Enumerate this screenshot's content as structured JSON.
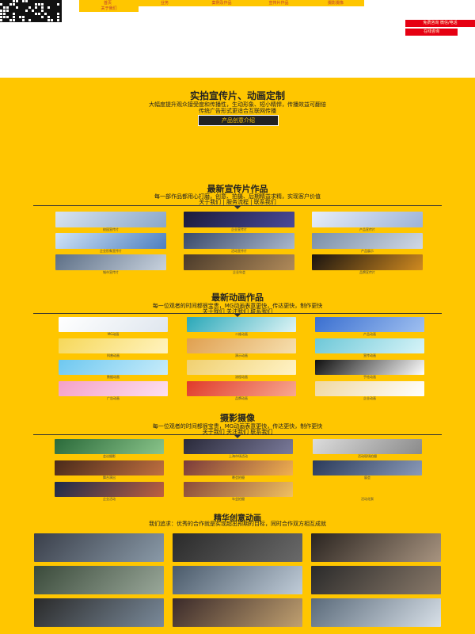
{
  "nav": {
    "items": [
      "首页",
      "业务",
      "案例及作品",
      "宣传片作品",
      "摄影摄像"
    ],
    "secondary": "关于我们"
  },
  "header": {
    "contact_button": "免费咨询 微信/电话",
    "consult_button": "在线咨询"
  },
  "hero": {
    "title": "实拍宣传片、动画定制",
    "line1": "大幅度提升观众接受度和传播性，生动形象、短小精悍，传播效益可翻倍",
    "line2": "传统广告形式更适合互联网传播",
    "button": "产品创意介绍"
  },
  "section1": {
    "title": "最新宣传片作品",
    "sub1": "每一部作品都用心打磨，创意、拍摄、后期精益求精，实现客户价值",
    "sub2": "关于我们 | 服务流程 | 联系我们",
    "captions": [
      "校园宣传片",
      "企业宣传片",
      "产品宣传片",
      "企业形象宣传片",
      "活动宣传片",
      "产品展示",
      "城市宣传片",
      "企业年会",
      "品牌宣传片"
    ]
  },
  "section2": {
    "title": "最新动画作品",
    "sub1": "每一位观者的时间都很宝贵，MG动画表意更快，传达更快，制作更快",
    "sub2": "关于我们  关注我们  联系我们",
    "captions": [
      "MG动画",
      "二维动画",
      "产品动画",
      "科普动画",
      "演示动画",
      "宣传动画",
      "数据动画",
      "流程动画",
      "手绘动画",
      "广告动画",
      "品牌动画",
      "企业动画"
    ]
  },
  "section3": {
    "title": "摄影摄像",
    "sub1": "每一位观者的时间都很宝贵，MG动画表意更快，传达更快，制作更快",
    "sub2": "关于我们  关注我们  联系我们",
    "captions": [
      "会议摄影",
      "上海市场活动",
      "活动现场拍摄",
      "舞台演出",
      "晚会拍摄",
      "展会",
      "企业活动",
      "年会拍摄",
      "活动花絮"
    ]
  },
  "section4": {
    "title": "精华创意动画",
    "sub1": "我们追求：优秀的合作就是实现超出预期的目标，同时合作双方相互成就"
  },
  "colors": {
    "accent": "#ffc600",
    "red": "#e60012",
    "dark": "#222222"
  }
}
